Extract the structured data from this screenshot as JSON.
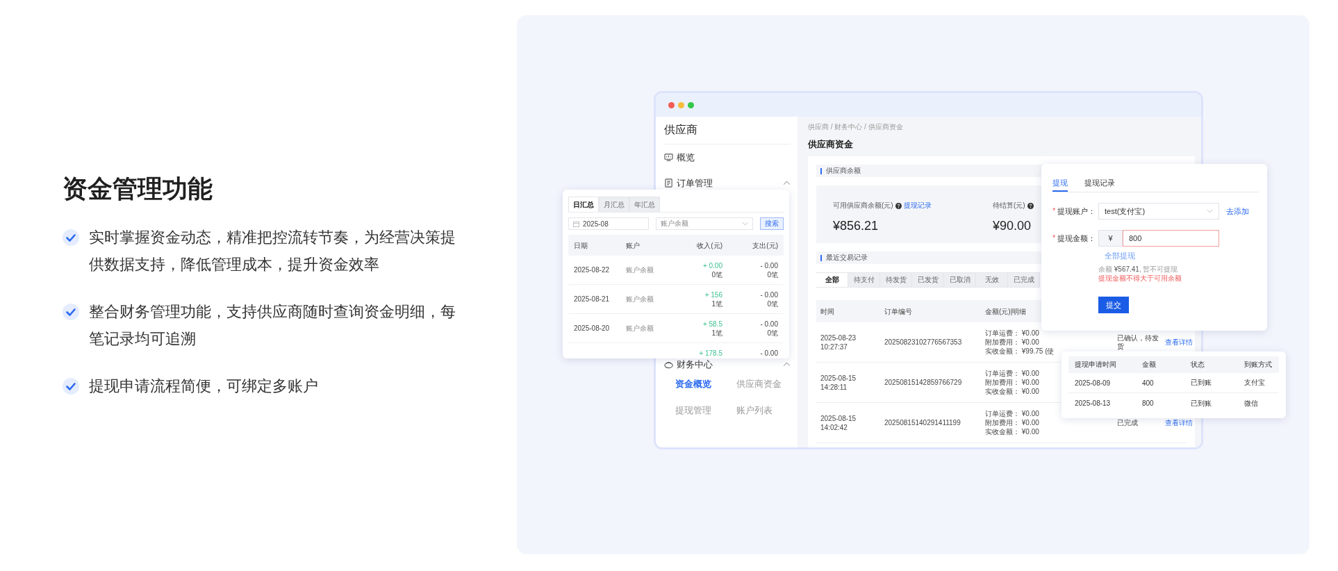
{
  "heading": "资金管理功能",
  "features": [
    "实时掌握资金动态，精准把控流转节奏，为经营决策提供数据支持，降低管理成本，提升资金效率",
    "整合财务管理功能，支持供应商随时查询资金明细，每笔记录均可追溯",
    "提现申请流程简便，可绑定多账户"
  ],
  "app_window": {
    "sidebar": {
      "title": "供应商",
      "items": [
        {
          "label": "概览",
          "kind": "link"
        },
        {
          "label": "订单管理",
          "kind": "group",
          "expanded": true
        },
        {
          "label": "财务中心",
          "kind": "group",
          "expanded": true,
          "children": [
            {
              "label": "资金概览",
              "selected": true
            },
            {
              "label": "供应商资金",
              "selected": false
            },
            {
              "label": "提现管理",
              "selected": false
            },
            {
              "label": "账户列表",
              "selected": false
            }
          ]
        }
      ]
    },
    "breadcrumb": "供应商 / 财务中心 / 供应商资金",
    "page_title": "供应商资金",
    "balance_section": {
      "title": "供应商余额",
      "stats": [
        {
          "label": "可用供应商余额(元)",
          "link": "提现记录",
          "value": "¥856.21"
        },
        {
          "label": "待结算(元)",
          "value": "¥90.00"
        }
      ]
    },
    "records_section": {
      "title": "最近交易记录",
      "tabs": [
        {
          "label": "全部",
          "selected": true
        },
        {
          "label": "待支付",
          "selected": false
        },
        {
          "label": "待发货",
          "selected": false
        },
        {
          "label": "已发货",
          "selected": false
        },
        {
          "label": "已取消",
          "selected": false
        },
        {
          "label": "无效",
          "selected": false
        },
        {
          "label": "已完成",
          "selected": false
        }
      ],
      "columns": [
        "时间",
        "订单编号",
        "金额(元)|明细"
      ],
      "rows": [
        {
          "time": "2025-08-23 10:27:37",
          "order_no": "20250823102776567353",
          "details": [
            "订单运费： ¥0.00",
            "附加费用： ¥0.00",
            "实收金额： ¥99.75 (使"
          ],
          "status": "已确认，待发货",
          "action": "查看详情"
        },
        {
          "time": "2025-08-15 14:28:11",
          "order_no": "20250815142859766729",
          "details": [
            "订单运费： ¥0.00",
            "附加费用： ¥0.00",
            "实收金额： ¥0.00"
          ]
        },
        {
          "time": "2025-08-15 14:02:42",
          "order_no": "20250815140291411199",
          "details": [
            "订单运费： ¥0.00",
            "附加费用： ¥0.00",
            "实收金额： ¥0.00"
          ],
          "status": "已完成",
          "action": "查看详情"
        }
      ]
    }
  },
  "summary_card": {
    "tabs": [
      {
        "label": "日汇总",
        "selected": true
      },
      {
        "label": "月汇总",
        "selected": false
      },
      {
        "label": "年汇总",
        "selected": false
      }
    ],
    "date": "2025-08",
    "account": "账户余额",
    "search": "搜索",
    "columns": [
      "日期",
      "账户",
      "收入(元)",
      "支出(元)"
    ],
    "rows": [
      {
        "date": "2025-08-22",
        "account": "账户余额",
        "income": "+ 0.00",
        "income_count": "0笔",
        "expense": "- 0.00",
        "expense_count": "0笔"
      },
      {
        "date": "2025-08-21",
        "account": "账户余额",
        "income": "+ 156",
        "income_count": "1笔",
        "expense": "- 0.00",
        "expense_count": "0笔"
      },
      {
        "date": "2025-08-20",
        "account": "账户余额",
        "income": "+ 58.5",
        "income_count": "1笔",
        "expense": "- 0.00",
        "expense_count": "0笔"
      },
      {
        "income": "+ 178.5",
        "expense": "- 0.00"
      }
    ]
  },
  "withdraw_card": {
    "tabs": [
      {
        "label": "提现",
        "selected": true
      },
      {
        "label": "提现记录",
        "selected": false
      }
    ],
    "fields": [
      {
        "kind": "select",
        "mark": "*",
        "label": "提现账户：",
        "value": "test(支付宝)",
        "link": "去添加",
        "error": false
      },
      {
        "kind": "amount",
        "mark": "*",
        "label": "提现金额：",
        "prefix": "¥",
        "value": "800",
        "error": true
      }
    ],
    "withdraw_all": "全部提现",
    "hint": "余额 **¥567.41**, 暂不可提现",
    "error_text": "提现金额不得大于可用余额",
    "submit": "提交"
  },
  "records_card": {
    "columns": [
      "提现申请时间",
      "金额",
      "状态",
      "到账方式"
    ],
    "rows": [
      [
        "2025-08-09",
        "400",
        "已到账",
        "支付宝"
      ],
      [
        "2025-08-13",
        "800",
        "已到账",
        "微信"
      ]
    ]
  }
}
